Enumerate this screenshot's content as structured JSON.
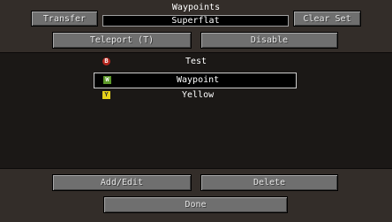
{
  "header": {
    "title": "Waypoints",
    "transfer_label": "Transfer",
    "world_name": "Superflat",
    "clear_set_label": "Clear Set",
    "teleport_label": "Teleport (T)",
    "disable_label": "Disable"
  },
  "waypoints": [
    {
      "initial": "B",
      "name": "Test",
      "color": "#b3261e",
      "selected": false
    },
    {
      "initial": "W",
      "name": "Waypoint",
      "color": "#5e9a2a",
      "selected": true
    },
    {
      "initial": "Y",
      "name": "Yellow",
      "color": "#e6d11a",
      "selected": false
    }
  ],
  "footer": {
    "add_edit_label": "Add/Edit",
    "delete_label": "Delete",
    "done_label": "Done"
  }
}
